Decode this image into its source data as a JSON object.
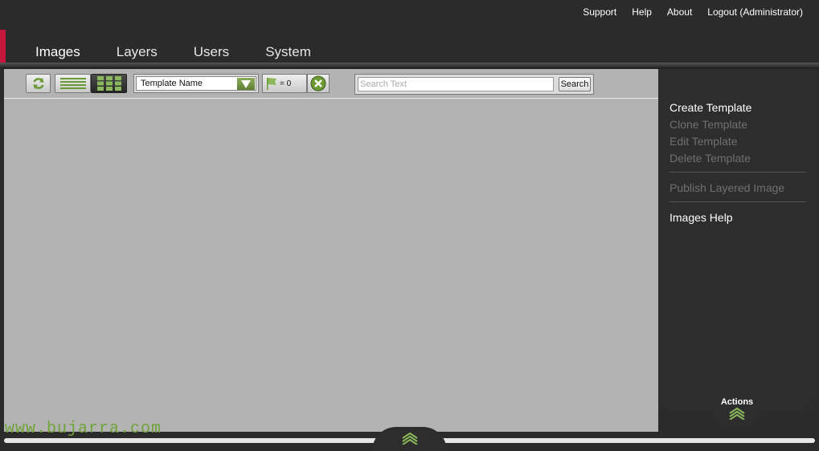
{
  "top_nav": {
    "support": "Support",
    "help": "Help",
    "about": "About",
    "logout": "Logout (Administrator)"
  },
  "tabs": [
    {
      "label": "Images",
      "active": true
    },
    {
      "label": "Layers",
      "active": false
    },
    {
      "label": "Users",
      "active": false
    },
    {
      "label": "System",
      "active": false
    }
  ],
  "toolbar": {
    "refresh_icon": "refresh-icon",
    "list_view_icon": "list-view-icon",
    "grid_view_icon": "grid-view-icon",
    "sort_selected": "Template Name",
    "flag_count": "= 0",
    "search_placeholder": "Search Text",
    "search_button": "Search"
  },
  "actions_panel": {
    "create": "Create Template",
    "clone": "Clone Template",
    "edit": "Edit Template",
    "delete": "Delete Template",
    "publish": "Publish Layered Image",
    "help": "Images Help",
    "footer_label": "Actions"
  },
  "watermark": "www.bujarra.com",
  "colors": {
    "accent": "#c4173b",
    "green": "#6fa33a",
    "background": "#2b2b2b",
    "content": "#b3b3b3"
  }
}
